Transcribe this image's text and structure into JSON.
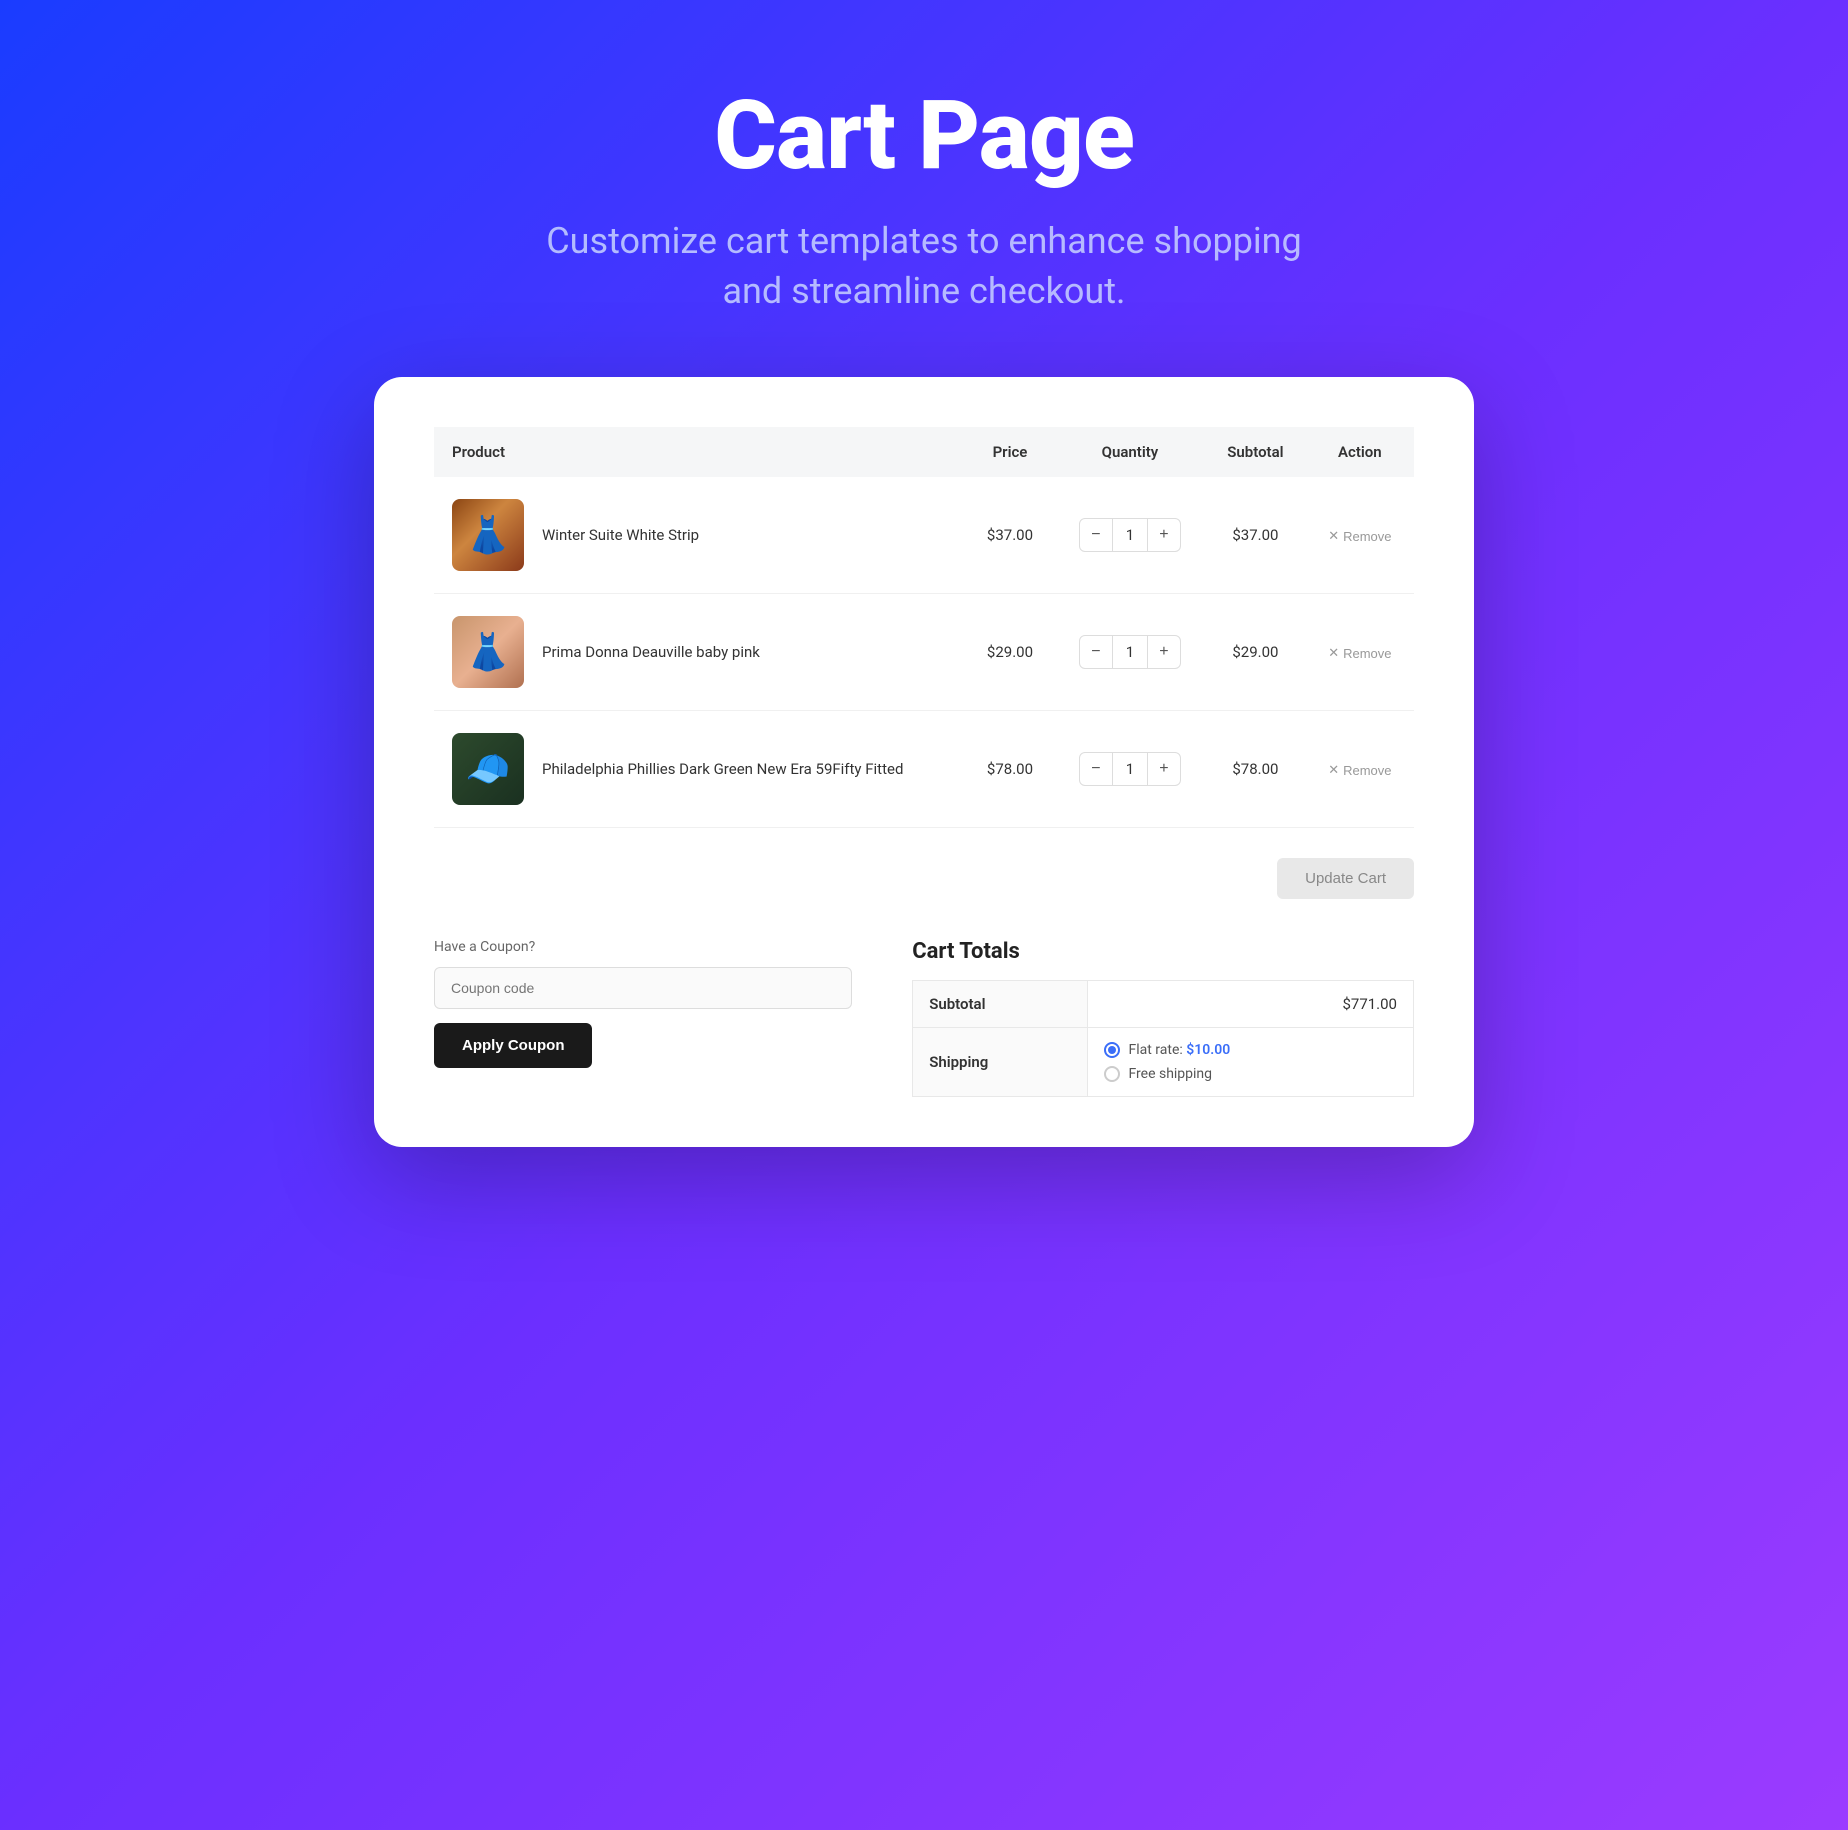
{
  "header": {
    "title": "Cart Page",
    "subtitle": "Customize cart templates to enhance shopping\nand streamline checkout."
  },
  "table": {
    "columns": {
      "product": "Product",
      "price": "Price",
      "quantity": "Quantity",
      "subtotal": "Subtotal",
      "action": "Action"
    },
    "rows": [
      {
        "id": 1,
        "name": "Winter Suite White Strip",
        "price": "$37.00",
        "quantity": 1,
        "subtotal": "$37.00",
        "image_type": "dress1"
      },
      {
        "id": 2,
        "name": "Prima Donna Deauville baby pink",
        "price": "$29.00",
        "quantity": 1,
        "subtotal": "$29.00",
        "image_type": "dress2"
      },
      {
        "id": 3,
        "name": "Philadelphia Phillies Dark Green New Era 59Fifty Fitted",
        "price": "$78.00",
        "quantity": 1,
        "subtotal": "$78.00",
        "image_type": "cap"
      }
    ],
    "remove_label": "Remove",
    "update_cart_label": "Update Cart"
  },
  "coupon": {
    "label": "Have a Coupon?",
    "placeholder": "Coupon code",
    "button_label": "Apply Coupon"
  },
  "cart_totals": {
    "title": "Cart Totals",
    "subtotal_label": "Subtotal",
    "subtotal_value": "$771.00",
    "shipping_label": "Shipping",
    "shipping_options": [
      {
        "label": "Flat rate: $10.00",
        "selected": true
      },
      {
        "label": "Free shipping",
        "selected": false
      }
    ]
  }
}
